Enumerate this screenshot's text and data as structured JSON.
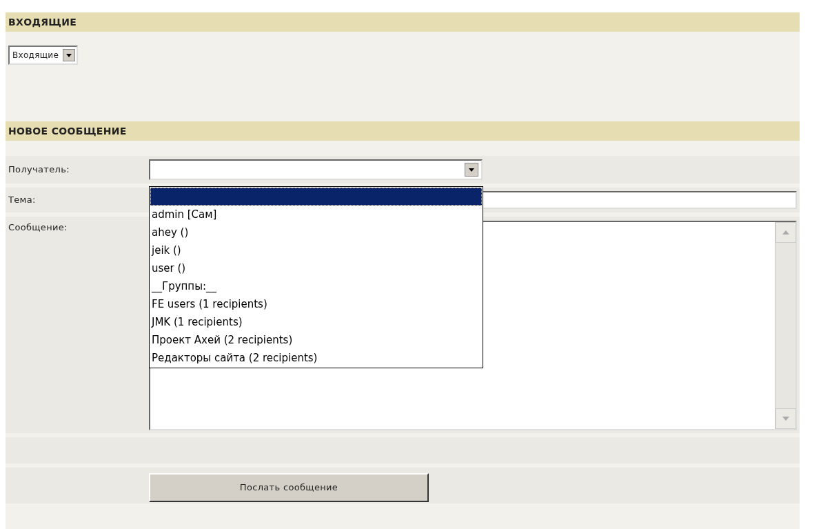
{
  "inbox": {
    "title": "ВХОДЯЩИЕ",
    "folder_select": {
      "value": "Входящие"
    }
  },
  "new_message": {
    "title": "НОВОЕ СООБЩЕНИЕ",
    "recipient": {
      "label": "Получатель:",
      "expanded": true,
      "options": [
        {
          "selected": true
        },
        {
          "label": "admin [Сам]",
          "selected": false
        },
        {
          "label": "ahey ()",
          "selected": false
        },
        {
          "label": "jeik ()",
          "selected": false
        },
        {
          "label": "user ()",
          "selected": false
        },
        {
          "label": "__Группы:__",
          "selected": false
        },
        {
          "label": "FE users (1 recipients)",
          "selected": false
        },
        {
          "label": "JMK (1 recipients)",
          "selected": false
        },
        {
          "label": "Проект Ахей (2 recipients)",
          "selected": false
        },
        {
          "label": "Редакторы сайта (2 recipients)",
          "selected": false
        }
      ]
    },
    "subject": {
      "label": "Тема:"
    },
    "message": {
      "label": "Сообщение:"
    },
    "send_button": "Послать сообщение"
  }
}
